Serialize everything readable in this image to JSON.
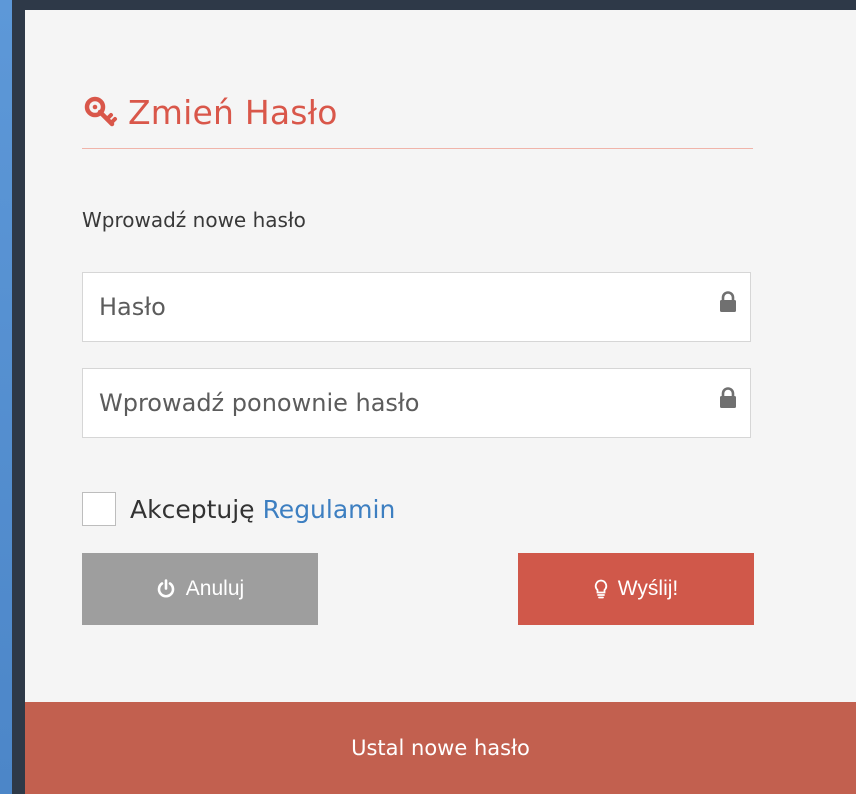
{
  "form": {
    "title": "Zmień Hasło",
    "title_icon": "key-icon",
    "prompt": "Wprowadź nowe hasło",
    "password": {
      "placeholder": "Hasło",
      "value": "",
      "icon": "lock-icon"
    },
    "password_confirm": {
      "placeholder": "Wprowadź ponownie hasło",
      "value": "",
      "icon": "lock-icon"
    },
    "accept": {
      "label": "Akceptuję",
      "link_text": "Regulamin",
      "checked": false
    },
    "cancel_button": {
      "label": "Anuluj",
      "icon": "power-icon"
    },
    "submit_button": {
      "label": "Wyślij!",
      "icon": "lightbulb-icon"
    }
  },
  "footer": {
    "label": "Ustal nowe hasło"
  },
  "colors": {
    "accent": "#d9574a",
    "link": "#3d7fc1",
    "cancel_bg": "#9e9e9e",
    "submit_bg": "#d0584a",
    "footer_bg": "#c2604f",
    "panel_bg": "#f5f5f5",
    "frame": "#2e3948"
  }
}
